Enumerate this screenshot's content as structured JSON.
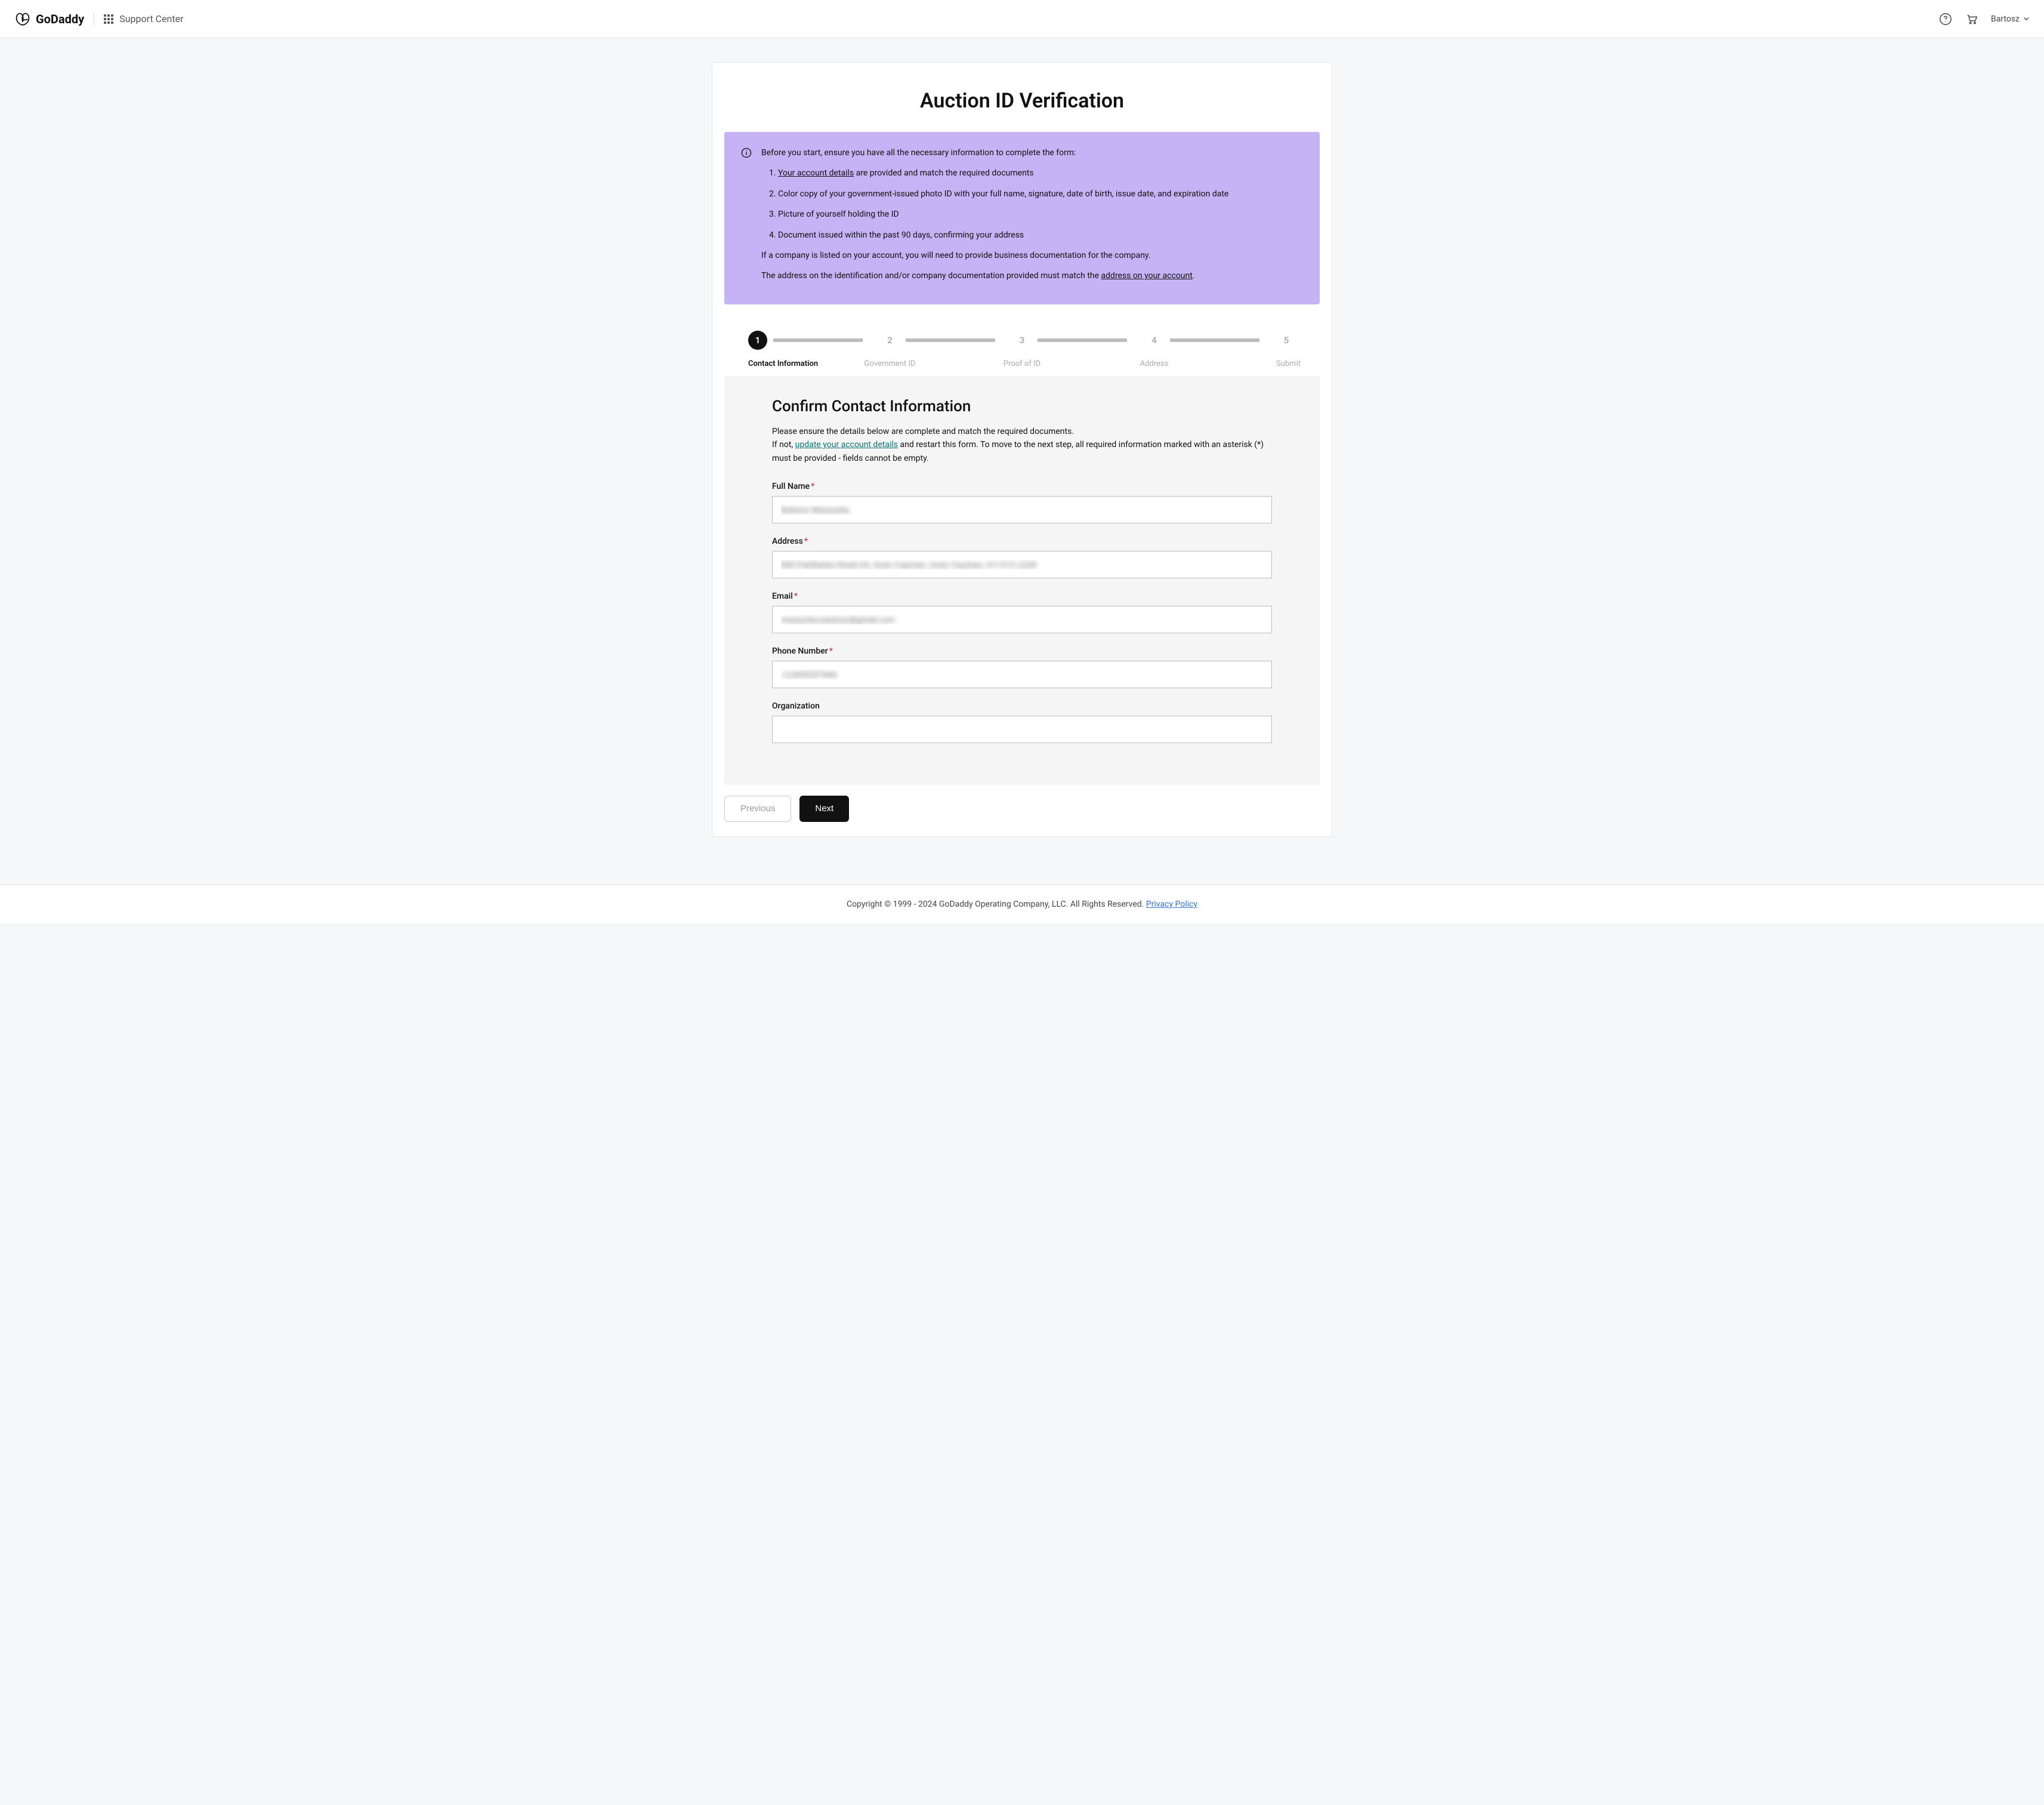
{
  "header": {
    "brand": "GoDaddy",
    "support_center": "Support Center",
    "user_name": "Bartosz"
  },
  "page": {
    "title": "Auction ID Verification"
  },
  "info_banner": {
    "intro": "Before you start, ensure you have all the necessary information to complete the form:",
    "item1_link": "Your account details",
    "item1_rest": " are provided and match the required documents",
    "item2": "Color copy of your government-issued photo ID with your full name, signature, date of birth, issue date, and expiration date",
    "item3": "Picture of yourself holding the ID",
    "item4": "Document issued within the past 90 days, confirming your address",
    "company_note": "If a company is listed on your account, you will need to provide business documentation for the company.",
    "address_note_pre": "The address on the identification and/or company documentation provided must match the ",
    "address_note_link": "address on your account",
    "address_note_post": "."
  },
  "stepper": {
    "steps": [
      {
        "num": "1",
        "label": "Contact Information",
        "active": true
      },
      {
        "num": "2",
        "label": "Government ID",
        "active": false
      },
      {
        "num": "3",
        "label": "Proof of ID",
        "active": false
      },
      {
        "num": "4",
        "label": "Address",
        "active": false
      },
      {
        "num": "5",
        "label": "Submit",
        "active": false
      }
    ]
  },
  "form": {
    "title": "Confirm Contact Information",
    "desc_line1": "Please ensure the details below are complete and match the required documents.",
    "desc_line2_pre": "If not, ",
    "desc_link": "update your account details",
    "desc_line2_post": "  and restart this form. To move to the next step, all required information marked with an asterisk (*) must be provided - fields cannot be empty.",
    "fields": {
      "full_name": {
        "label": "Full Name",
        "required": true,
        "value": "Bartosz Maszynka"
      },
      "address": {
        "label": "Address",
        "required": true,
        "value": "895 FairBanks Road #4, Gran Cayman, Gran Cayman, KY KY1-1106"
      },
      "email": {
        "label": "Email",
        "required": true,
        "value": "maszynka.bartosz@gmail.com"
      },
      "phone": {
        "label": "Phone Number",
        "required": true,
        "value": "+13455257946"
      },
      "organization": {
        "label": "Organization",
        "required": false,
        "value": ""
      }
    }
  },
  "nav": {
    "prev": "Previous",
    "next": "Next"
  },
  "footer": {
    "copyright": "Copyright © 1999 - 2024 GoDaddy Operating Company, LLC. All Rights Reserved. ",
    "privacy": "Privacy Policy"
  }
}
